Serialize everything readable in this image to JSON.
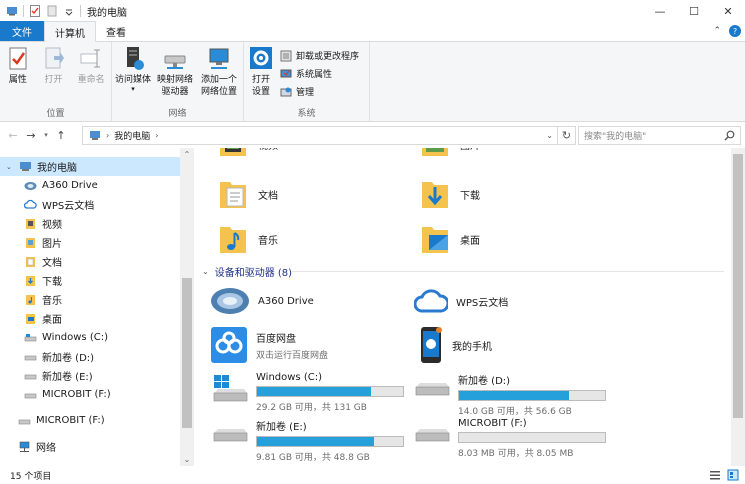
{
  "window": {
    "title": "我的电脑",
    "controls": [
      "—",
      "☐",
      "✕"
    ]
  },
  "tabs": {
    "file": "文件",
    "computer": "计算机",
    "view": "查看"
  },
  "ribbon": {
    "location_group": {
      "label": "位置",
      "properties": "属性",
      "open": "打开",
      "rename": "重命名"
    },
    "network_group": {
      "label": "网络",
      "access_media_1": "访问媒体",
      "map_drive_1": "映射网络",
      "map_drive_2": "驱动器",
      "add_location_1": "添加一个",
      "add_location_2": "网络位置"
    },
    "system_group": {
      "label": "系统",
      "open_settings_1": "打开",
      "open_settings_2": "设置",
      "uninstall": "卸载或更改程序",
      "system_props": "系统属性",
      "manage": "管理"
    }
  },
  "address": {
    "path": "我的电脑",
    "search_placeholder": "搜索\"我的电脑\""
  },
  "sidebar": {
    "items": [
      {
        "label": "我的电脑",
        "icon": "computer-icon"
      },
      {
        "label": "A360 Drive",
        "icon": "a360-icon"
      },
      {
        "label": "WPS云文档",
        "icon": "cloud-icon"
      },
      {
        "label": "视频",
        "icon": "video-folder-icon"
      },
      {
        "label": "图片",
        "icon": "picture-folder-icon"
      },
      {
        "label": "文档",
        "icon": "document-folder-icon"
      },
      {
        "label": "下载",
        "icon": "download-folder-icon"
      },
      {
        "label": "音乐",
        "icon": "music-folder-icon"
      },
      {
        "label": "桌面",
        "icon": "desktop-folder-icon"
      },
      {
        "label": "Windows (C:)",
        "icon": "drive-icon"
      },
      {
        "label": "新加卷 (D:)",
        "icon": "drive-icon"
      },
      {
        "label": "新加卷 (E:)",
        "icon": "drive-icon"
      },
      {
        "label": "MICROBIT (F:)",
        "icon": "drive-icon"
      },
      {
        "label": "MICROBIT (F:)",
        "icon": "usb-drive-icon"
      },
      {
        "label": "网络",
        "icon": "network-icon"
      }
    ]
  },
  "folders": {
    "top_left_partial": "视频",
    "top_right_partial": "图片",
    "documents": "文档",
    "downloads": "下载",
    "music": "音乐",
    "desktop": "桌面"
  },
  "devices": {
    "header": "设备和驱动器 (8)",
    "a360": "A360 Drive",
    "wps": "WPS云文档",
    "baidu": "百度网盘",
    "baidu_sub": "双击运行百度网盘",
    "phone": "我的手机",
    "drive_c": {
      "name": "Windows (C:)",
      "info": "29.2 GB 可用，共 131 GB",
      "used_fraction": 0.78
    },
    "drive_d": {
      "name": "新加卷 (D:)",
      "info": "14.0 GB 可用，共 56.6 GB",
      "used_fraction": 0.75
    },
    "drive_e": {
      "name": "新加卷 (E:)",
      "info": "9.81 GB 可用，共 48.8 GB",
      "used_fraction": 0.8
    },
    "drive_f": {
      "name": "MICROBIT (F:)",
      "info": "8.03 MB 可用，共 8.05 MB",
      "used_fraction": 0.0
    }
  },
  "status": {
    "count": "15 个项目"
  },
  "colors": {
    "accent": "#1979ca",
    "bar_fill": "#26a0da",
    "folder": "#f3c34e"
  }
}
